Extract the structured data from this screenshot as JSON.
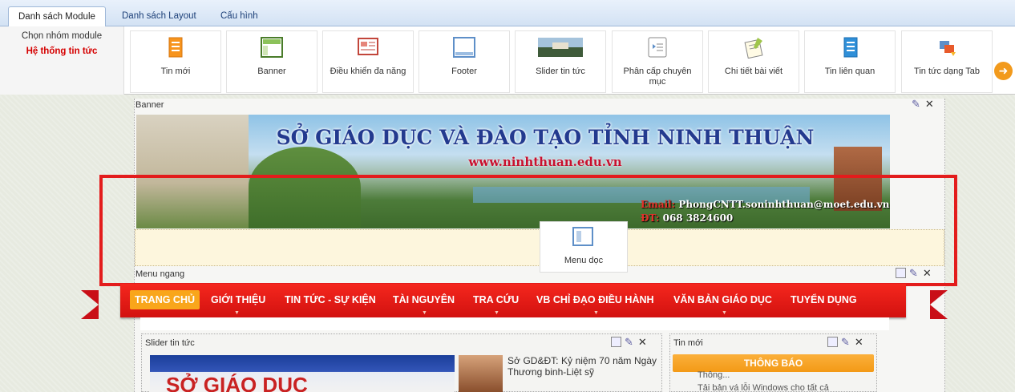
{
  "tabs": [
    {
      "label": "Danh sách Module",
      "active": true
    },
    {
      "label": "Danh sách Layout",
      "active": false
    },
    {
      "label": "Cấu hình",
      "active": false
    }
  ],
  "groups": {
    "header": "Chọn nhóm module",
    "selected": "Hệ thống tin tức"
  },
  "modules": [
    {
      "label": "Tin mới",
      "icon": "orange-document-icon"
    },
    {
      "label": "Banner",
      "icon": "banner-layout-icon"
    },
    {
      "label": "Điều khiển đa năng",
      "icon": "multi-control-icon"
    },
    {
      "label": "Footer",
      "icon": "footer-layout-icon"
    },
    {
      "label": "Slider tin tức",
      "icon": "slider-image-icon"
    },
    {
      "label": "Phân cấp chuyên mục",
      "icon": "category-tree-icon"
    },
    {
      "label": "Chi tiết bài viết",
      "icon": "article-detail-icon"
    },
    {
      "label": "Tin liên quan",
      "icon": "related-news-icon"
    },
    {
      "label": "Tin tức dạng Tab",
      "icon": "tab-news-icon"
    }
  ],
  "zones": {
    "banner_label": "Banner",
    "menu_label": "Menu ngang",
    "slider_label": "Slider tin tức",
    "news_label": "Tin mới"
  },
  "banner": {
    "title": "SỞ GIÁO DỤC VÀ ĐÀO TẠO TỈNH NINH THUẬN",
    "url": "www.ninhthuan.edu.vn",
    "email_key": "Email:",
    "email_value": "PhongCNTT.soninhthuan@moet.edu.vn",
    "phone_key": "ĐT:",
    "phone_value": "068 3824600"
  },
  "dragging_module": {
    "label": "Menu dọc",
    "icon": "vertical-menu-icon"
  },
  "nav": [
    {
      "label": "TRANG CHỦ",
      "active": true,
      "caret": false
    },
    {
      "label": "GIỚI THIỆU",
      "active": false,
      "caret": true
    },
    {
      "label": "TIN TỨC - SỰ KIỆN",
      "active": false,
      "caret": false
    },
    {
      "label": "TÀI NGUYÊN",
      "active": false,
      "caret": true
    },
    {
      "label": "TRA CỨU",
      "active": false,
      "caret": true
    },
    {
      "label": "VB CHỈ ĐẠO ĐIỀU HÀNH",
      "active": false,
      "caret": true
    },
    {
      "label": "VĂN BẢN GIÁO DỤC",
      "active": false,
      "caret": true
    },
    {
      "label": "TUYỂN DỤNG",
      "active": false,
      "caret": false
    }
  ],
  "slider": {
    "image_text": "SỞ GIÁO DỤC",
    "news_title": "Sở GD&ĐT: Kỷ niệm 70 năm Ngày Thương binh-Liệt sỹ"
  },
  "news_panel": {
    "header": "THÔNG BÁO",
    "line1": "Thông...",
    "line2": "Tải bản vá lỗi Windows cho tất cả"
  },
  "colors": {
    "accent_red": "#e31c1c",
    "ribbon_red": "#d2110f",
    "active_orange": "#f9a61b",
    "group_red": "#d50000"
  }
}
